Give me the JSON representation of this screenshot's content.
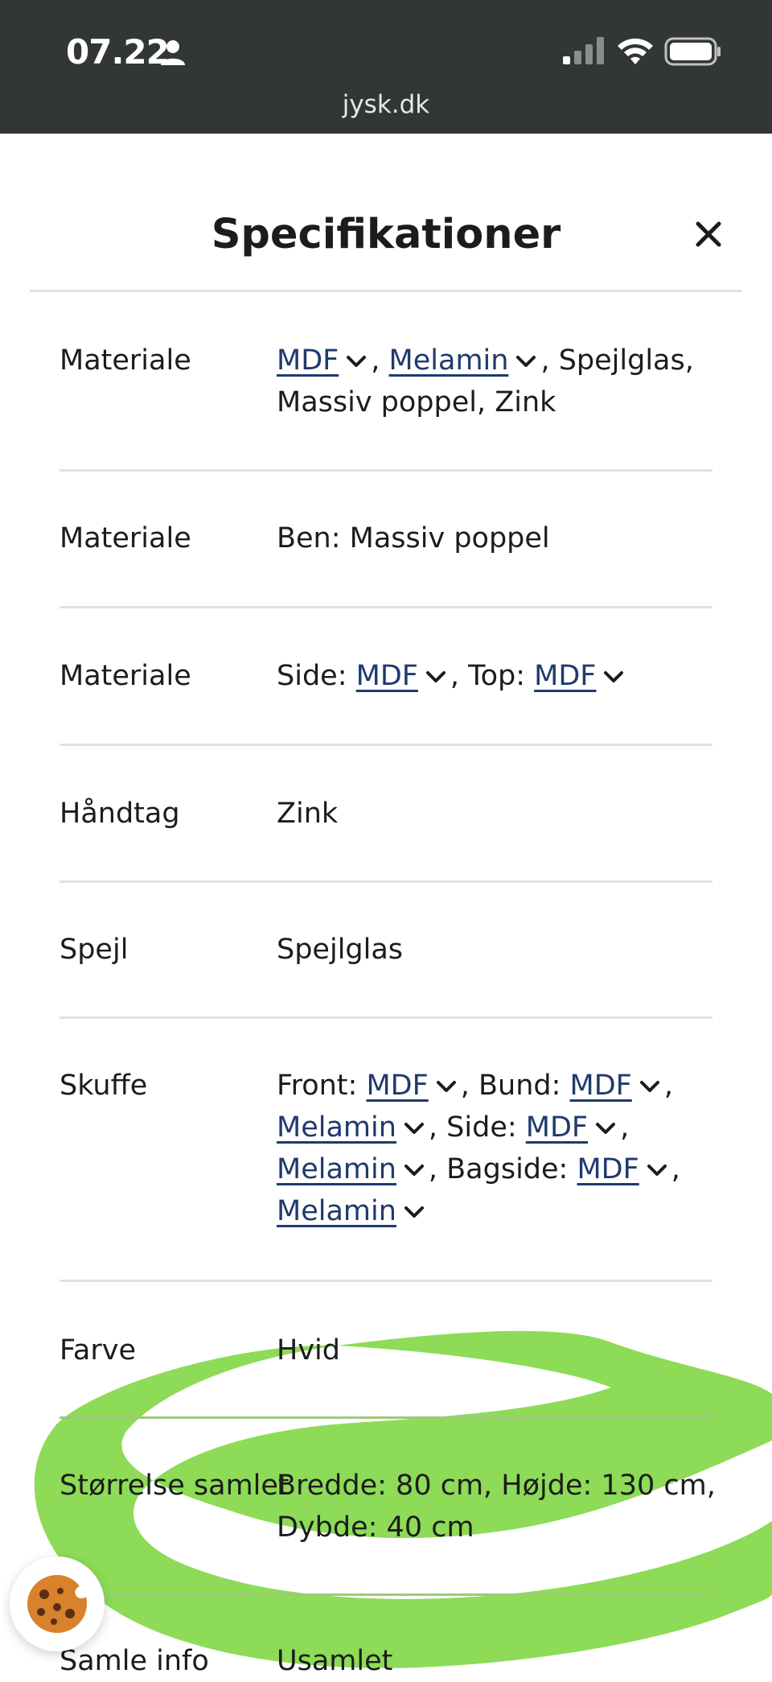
{
  "status_bar": {
    "time": "07.22",
    "url": "jysk.dk"
  },
  "modal": {
    "title": "Specifikationer",
    "close_icon": "close-icon"
  },
  "specs": {
    "materiale1": {
      "label": "Materiale",
      "link1": "MDF",
      "link2": "Melamin",
      "text_after": ", Spejlglas,",
      "line2": "Massiv poppel, Zink"
    },
    "materiale2": {
      "label": "Materiale",
      "value": "Ben: Massiv poppel"
    },
    "materiale3": {
      "label": "Materiale",
      "side_prefix": "Side:",
      "side_link": "MDF",
      "top_prefix": ", Top:",
      "top_link": "MDF"
    },
    "haandtag": {
      "label": "Håndtag",
      "value": "Zink"
    },
    "spejl": {
      "label": "Spejl",
      "value": "Spejlglas"
    },
    "skuffe": {
      "label": "Skuffe",
      "front_prefix": "Front:",
      "front_link": "MDF",
      "bund_prefix": ", Bund:",
      "bund_link": "MDF",
      "comma": ",",
      "melamin1": "Melamin",
      "side_prefix": ", Side:",
      "side_link": "MDF",
      "melamin2": "Melamin",
      "bagside_prefix": ", Bagside:",
      "bagside_link": "MDF",
      "melamin3": "Melamin"
    },
    "farve": {
      "label": "Farve",
      "value": "Hvid"
    },
    "stoerrelse": {
      "label": "Størrelse samlet",
      "line1": "Bredde: 80 cm, Højde: 130 cm,",
      "line2": "Dybde: 40 cm"
    },
    "samle_info": {
      "label": "Samle info",
      "value": "Usamlet"
    }
  },
  "colors": {
    "status_bar": "#323637",
    "link": "#1f3a6e",
    "highlight": "#7dd640",
    "divider": "#e1e1e1"
  },
  "icons": [
    "person-icon",
    "signal-icon",
    "wifi-icon",
    "battery-icon",
    "chevron-down-icon",
    "cookie-icon"
  ]
}
